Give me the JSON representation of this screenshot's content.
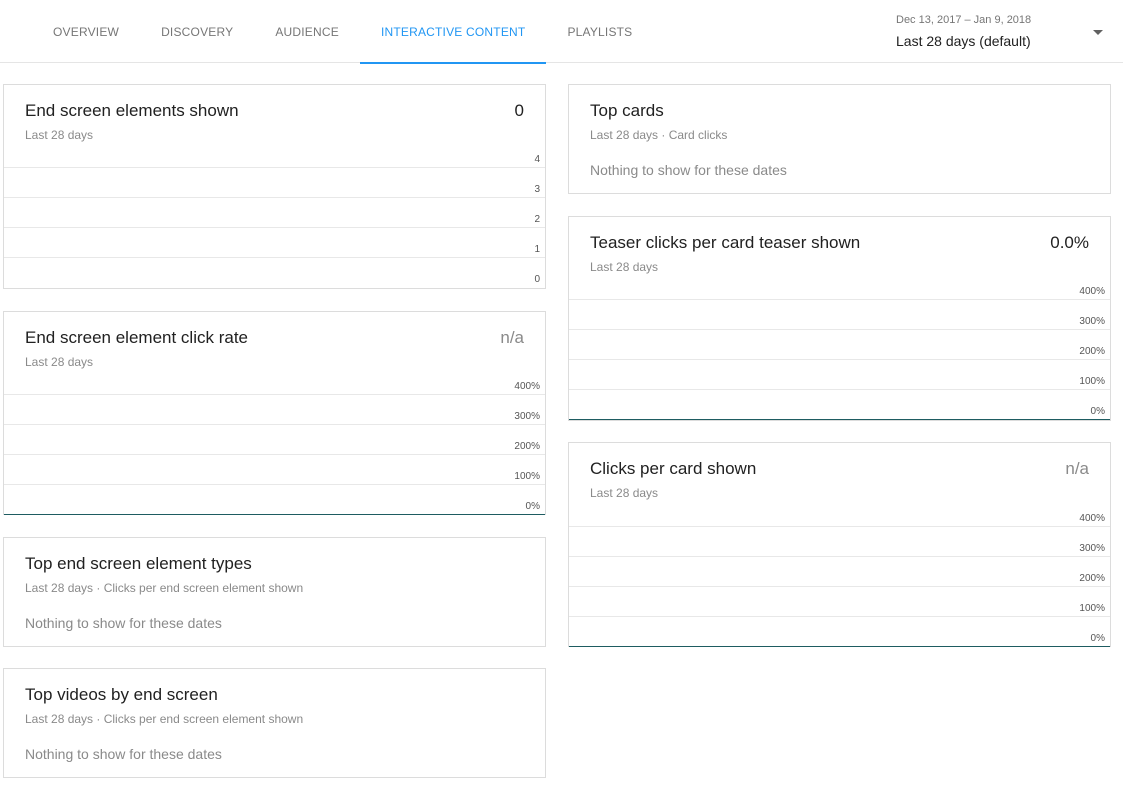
{
  "header": {
    "tabs": [
      {
        "label": "OVERVIEW",
        "active": false
      },
      {
        "label": "DISCOVERY",
        "active": false
      },
      {
        "label": "AUDIENCE",
        "active": false
      },
      {
        "label": "INTERACTIVE CONTENT",
        "active": true
      },
      {
        "label": "PLAYLISTS",
        "active": false
      }
    ],
    "date_range": "Dec 13, 2017 – Jan 9, 2018",
    "date_preset": "Last 28 days (default)"
  },
  "cards": {
    "end_screen_shown": {
      "title": "End screen elements shown",
      "value": "0",
      "subtitle": "Last 28 days",
      "y_ticks": [
        "4",
        "3",
        "2",
        "1",
        "0"
      ]
    },
    "end_screen_click_rate": {
      "title": "End screen element click rate",
      "value": "n/a",
      "subtitle": "Last 28 days",
      "y_ticks": [
        "400%",
        "300%",
        "200%",
        "100%",
        "0%"
      ]
    },
    "top_end_screen_types": {
      "title": "Top end screen element types",
      "subtitle": "Last 28 days · Clicks per end screen element shown",
      "empty": "Nothing to show for these dates"
    },
    "top_videos_end_screen": {
      "title": "Top videos by end screen",
      "subtitle": "Last 28 days · Clicks per end screen element shown",
      "empty": "Nothing to show for these dates"
    },
    "top_cards": {
      "title": "Top cards",
      "subtitle": "Last 28 days · Card clicks",
      "empty": "Nothing to show for these dates"
    },
    "teaser_clicks": {
      "title": "Teaser clicks per card teaser shown",
      "value": "0.0%",
      "subtitle": "Last 28 days",
      "y_ticks": [
        "400%",
        "300%",
        "200%",
        "100%",
        "0%"
      ]
    },
    "clicks_per_card": {
      "title": "Clicks per card shown",
      "value": "n/a",
      "subtitle": "Last 28 days",
      "y_ticks": [
        "400%",
        "300%",
        "200%",
        "100%",
        "0%"
      ]
    }
  },
  "colors": {
    "accent": "#2196f3",
    "baseline": "#1e5c61"
  }
}
